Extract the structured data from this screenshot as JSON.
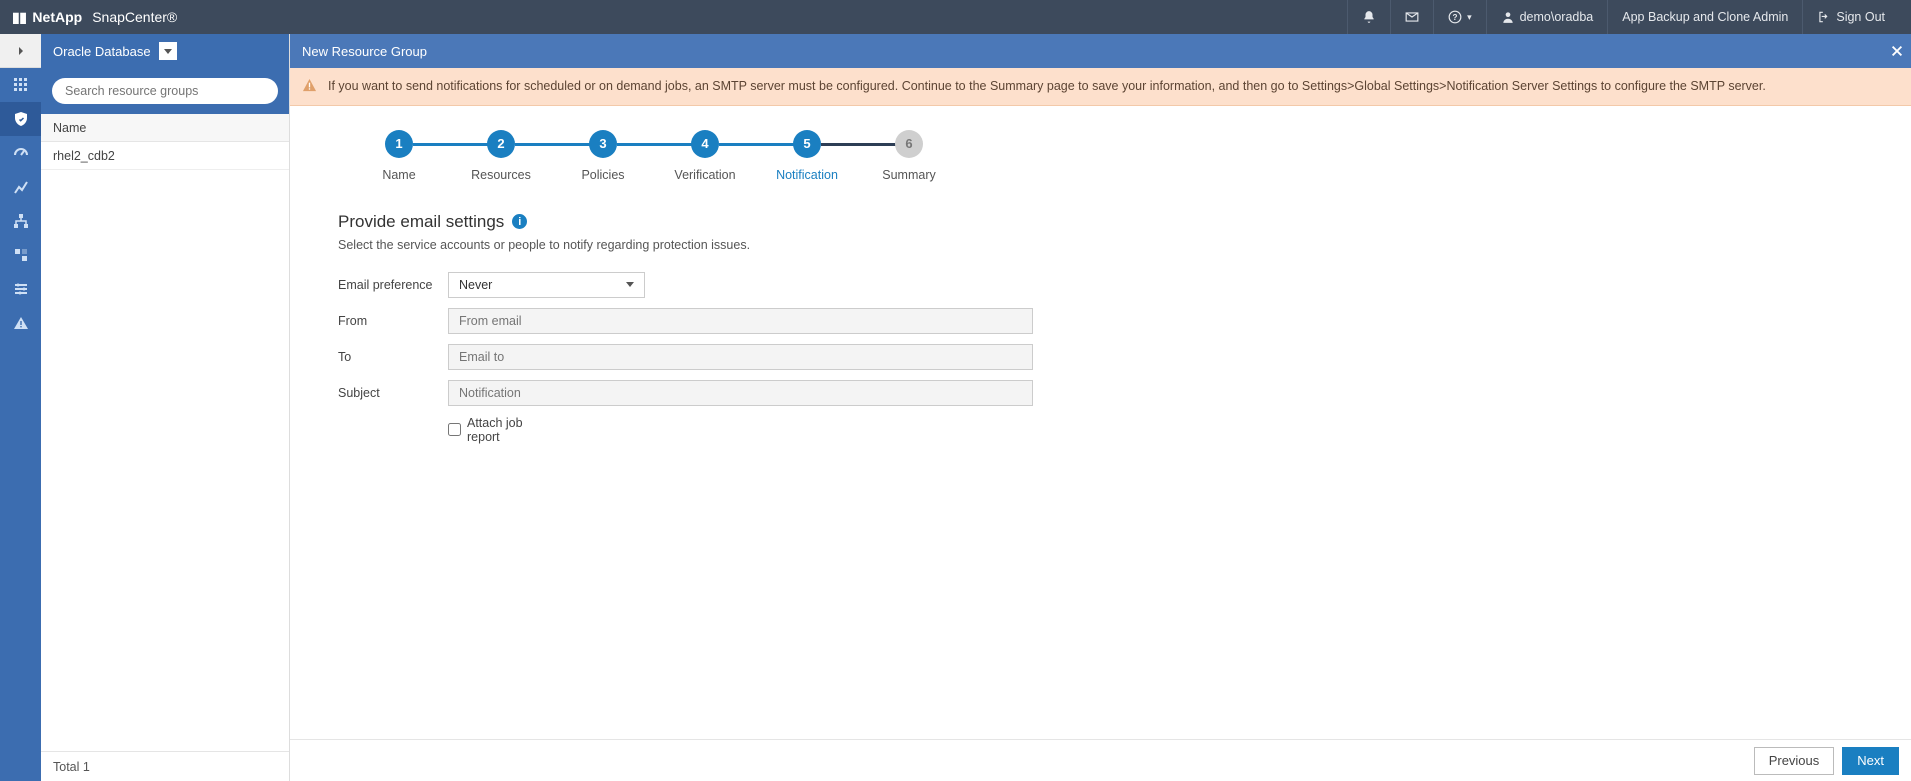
{
  "brand": {
    "company": "NetApp",
    "app": "SnapCenter®"
  },
  "topbar": {
    "user": "demo\\oradba",
    "role": "App Backup and Clone Admin",
    "signout": "Sign Out"
  },
  "leftpanel": {
    "selector": "Oracle Database",
    "search_placeholder": "Search resource groups",
    "col_name": "Name",
    "rows": [
      "rhel2_cdb2"
    ],
    "total_label": "Total 1"
  },
  "subheader": {
    "title": "New Resource Group"
  },
  "alert": {
    "text": "If you want to send notifications for scheduled or on demand jobs, an SMTP server must be configured. Continue to the Summary page to save your information, and then go to Settings>Global Settings>Notification Server Settings to configure the SMTP server."
  },
  "steps": [
    {
      "num": "1",
      "label": "Name",
      "state": "done"
    },
    {
      "num": "2",
      "label": "Resources",
      "state": "done"
    },
    {
      "num": "3",
      "label": "Policies",
      "state": "done"
    },
    {
      "num": "4",
      "label": "Verification",
      "state": "done"
    },
    {
      "num": "5",
      "label": "Notification",
      "state": "current"
    },
    {
      "num": "6",
      "label": "Summary",
      "state": "pending"
    }
  ],
  "section": {
    "title": "Provide email settings",
    "sub": "Select the service accounts or people to notify regarding protection issues.",
    "fields": {
      "email_preference_label": "Email preference",
      "email_preference_value": "Never",
      "from_label": "From",
      "from_placeholder": "From email",
      "to_label": "To",
      "to_placeholder": "Email to",
      "subject_label": "Subject",
      "subject_placeholder": "Notification",
      "attach_label": "Attach job report"
    }
  },
  "buttons": {
    "prev": "Previous",
    "next": "Next"
  }
}
